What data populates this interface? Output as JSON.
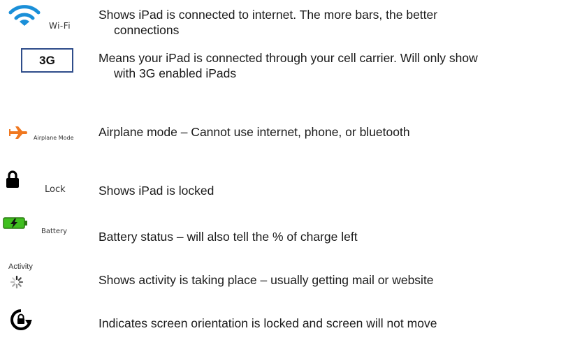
{
  "items": [
    {
      "icon": "wifi-icon",
      "icon_label": "Wi-Fi",
      "line1": "Shows  iPad is connected to internet.  The more bars, the better",
      "line2": "connections"
    },
    {
      "icon": "3g-badge",
      "icon_label": "3G",
      "line1": "Means your iPad is connected through your cell carrier.  Will only show",
      "line2": "with 3G enabled iPads"
    },
    {
      "icon": "airplane-icon",
      "icon_label": "Airplane Mode",
      "line1": "Airplane mode – Cannot use internet, phone, or bluetooth"
    },
    {
      "icon": "lock-icon",
      "icon_label": "Lock",
      "line1": "Shows iPad is locked"
    },
    {
      "icon": "battery-icon",
      "icon_label": "Battery",
      "line1": "Battery status – will also tell the % of charge left"
    },
    {
      "icon": "activity-spinner-icon",
      "icon_label": "Activity",
      "line1": "Shows activity is taking place – usually getting mail or website"
    },
    {
      "icon": "orientation-lock-icon",
      "line1": "Indicates screen orientation is locked and screen will not move"
    }
  ],
  "colors": {
    "wifi": "#1a8fd8",
    "airplane": "#f07820",
    "battery": "#3fbf1f",
    "badge_border": "#2f4d8a"
  }
}
